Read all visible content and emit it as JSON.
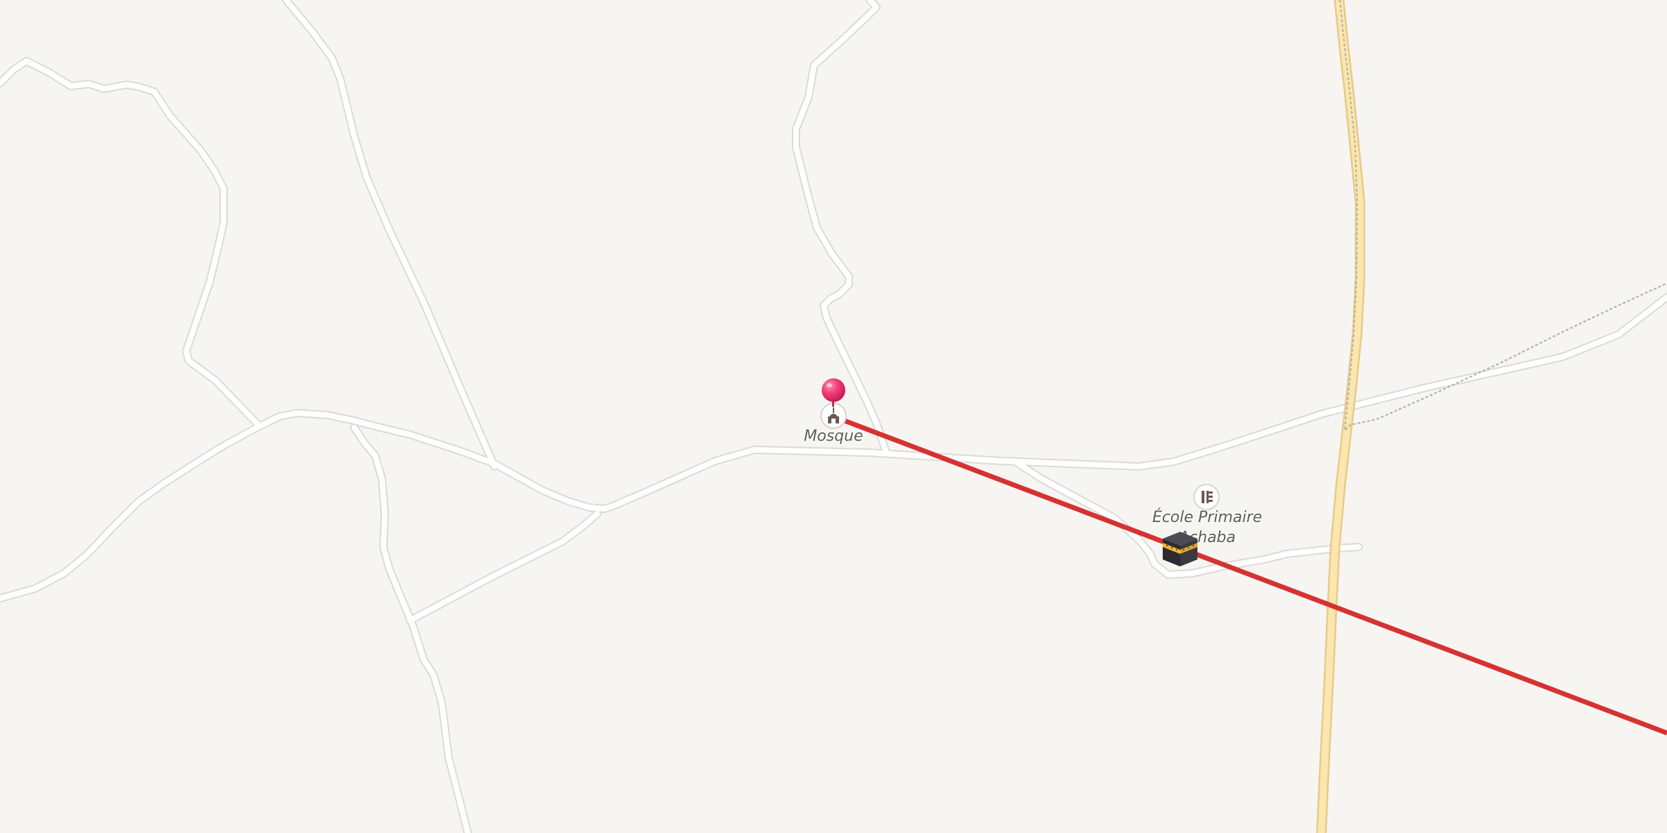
{
  "map": {
    "colors": {
      "background": "#f7f5f1",
      "minor_road": "#ffffff",
      "minor_road_casing": "#dcdad6",
      "main_road": "#fbe7ad",
      "main_road_casing": "#e8c98a",
      "route": "#d63232",
      "pin": "#ec2f6a",
      "label": "#5f5c58"
    },
    "pois": [
      {
        "name": "Mosque",
        "icon": "mosque-icon"
      },
      {
        "name": "École Primaire\nAchaba",
        "icon": "school-icon"
      }
    ],
    "markers": [
      {
        "type": "pin",
        "icon": "map-pin-icon"
      },
      {
        "type": "destination",
        "icon": "kaaba-icon"
      }
    ],
    "route": {
      "icon": "route-line"
    }
  }
}
